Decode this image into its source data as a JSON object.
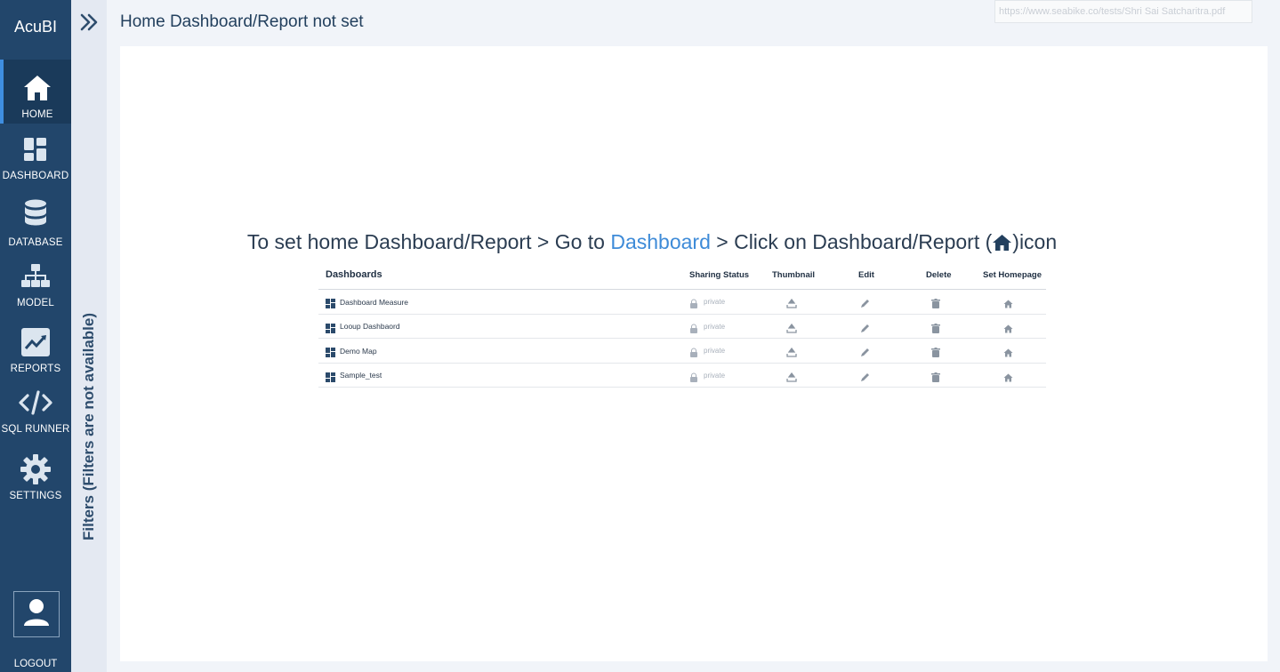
{
  "app": {
    "brand": "AcuBI"
  },
  "sidebar": {
    "items": [
      {
        "key": "home",
        "label": "HOME",
        "icon": "home-icon"
      },
      {
        "key": "dashboard",
        "label": "DASHBOARD",
        "icon": "dashboard-icon"
      },
      {
        "key": "database",
        "label": "DATABASE",
        "icon": "database-icon"
      },
      {
        "key": "model",
        "label": "MODEL",
        "icon": "sitemap-icon"
      },
      {
        "key": "reports",
        "label": "REPORTS",
        "icon": "chart-line-icon"
      },
      {
        "key": "sql_runner",
        "label": "SQL RUNNER",
        "icon": "code-icon"
      },
      {
        "key": "settings",
        "label": "SETTINGS",
        "icon": "gear-icon"
      }
    ],
    "logout_label": "LOGOUT"
  },
  "filters": {
    "label": "Filters (Filters are not available)"
  },
  "header": {
    "title": "Home Dashboard/Report not set"
  },
  "tooltip": {
    "text": "https://www.seabike.co/tests/Shri Sai Satcharitra.pdf"
  },
  "instruction": {
    "prefix": "To set home Dashboard/Report > Go to ",
    "link": "Dashboard",
    "middle": " > Click on Dashboard/Report (",
    "suffix": ")icon"
  },
  "sample_table": {
    "columns": {
      "name": "Dashboards",
      "sharing": "Sharing Status",
      "thumbnail": "Thumbnail",
      "edit": "Edit",
      "delete": "Delete",
      "homepage": "Set Homepage"
    },
    "rows": [
      {
        "name": "Dashboard Measure",
        "sharing": "private"
      },
      {
        "name": "Looup Dashbaord",
        "sharing": "private"
      },
      {
        "name": "Demo Map",
        "sharing": "private"
      },
      {
        "name": "Sample_test",
        "sharing": "private"
      }
    ]
  },
  "colors": {
    "sidebar": "#22466b",
    "sidebar_active": "#1a3a5a",
    "accent": "#3e8bd8",
    "filter_strip": "#e4e9f2",
    "background": "#f1f4f9"
  }
}
